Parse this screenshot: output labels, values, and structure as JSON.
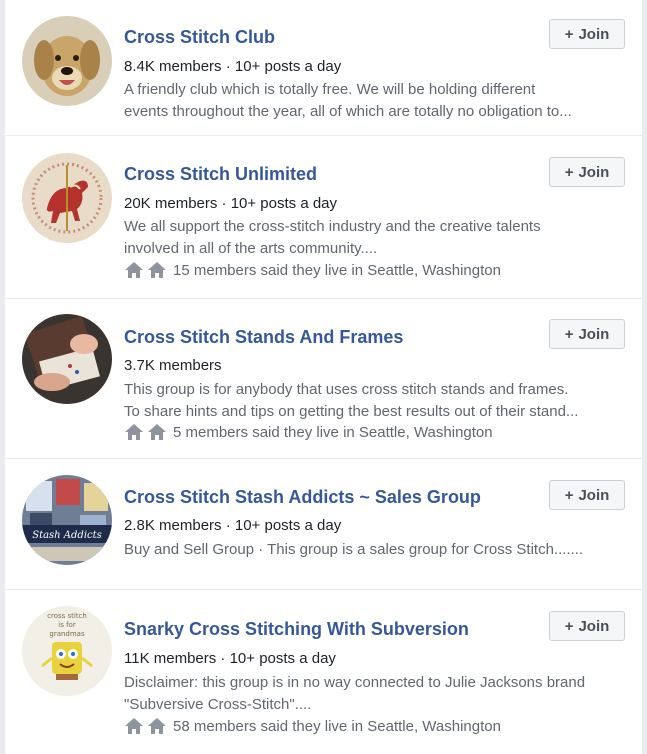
{
  "groups": [
    {
      "name": "Cross Stitch Club",
      "meta": "8.4K members · 10+ posts a day",
      "desc_line1": "A friendly club which is totally free. We will be holding different",
      "desc_line2": "events throughout the year, all of which are totally no obligation to...",
      "location": "",
      "join_label": "Join",
      "avatar_icon": "dog-portrait-icon"
    },
    {
      "name": "Cross Stitch Unlimited",
      "meta": "20K members · 10+ posts a day",
      "desc_line1": "We all support the cross-stitch industry and the creative talents",
      "desc_line2": "involved in all of the arts community....",
      "location": "15 members said they live in Seattle, Washington",
      "join_label": "Join",
      "avatar_icon": "carousel-horse-icon"
    },
    {
      "name": "Cross Stitch Stands And Frames",
      "meta": "3.7K members",
      "desc_line1": "This group is for anybody that uses cross stitch stands and frames.",
      "desc_line2": "To share hints and tips on getting the best results out of their stand...",
      "location": "5 members said they live in Seattle, Washington",
      "join_label": "Join",
      "avatar_icon": "stitching-hands-icon"
    },
    {
      "name": "Cross Stitch Stash Addicts ~ Sales Group",
      "meta": "2.8K members · 10+ posts a day",
      "desc_line1": "Buy and Sell Group · This group is a sales group for Cross Stitch.......",
      "desc_line2": "",
      "location": "",
      "join_label": "Join",
      "avatar_icon": "stash-addicts-logo-icon",
      "avatar_logo_text": "Stash Addicts"
    },
    {
      "name": "Snarky Cross Stitching With Subversion",
      "meta": "11K members · 10+ posts a day",
      "desc_line1": "Disclaimer: this group is in no way connected to Julie Jacksons brand",
      "desc_line2": "\"Subversive Cross-Stitch\"....",
      "location": "58 members said they live in Seattle, Washington",
      "join_label": "Join",
      "avatar_icon": "cartoon-sponge-icon",
      "avatar_logo_text": "cross stitch is for grandmas"
    }
  ],
  "colors": {
    "background": "#e9ebee",
    "card": "#ffffff",
    "title_link": "#365899",
    "secondary_text": "#606770",
    "house_icon": "#8d949e"
  }
}
